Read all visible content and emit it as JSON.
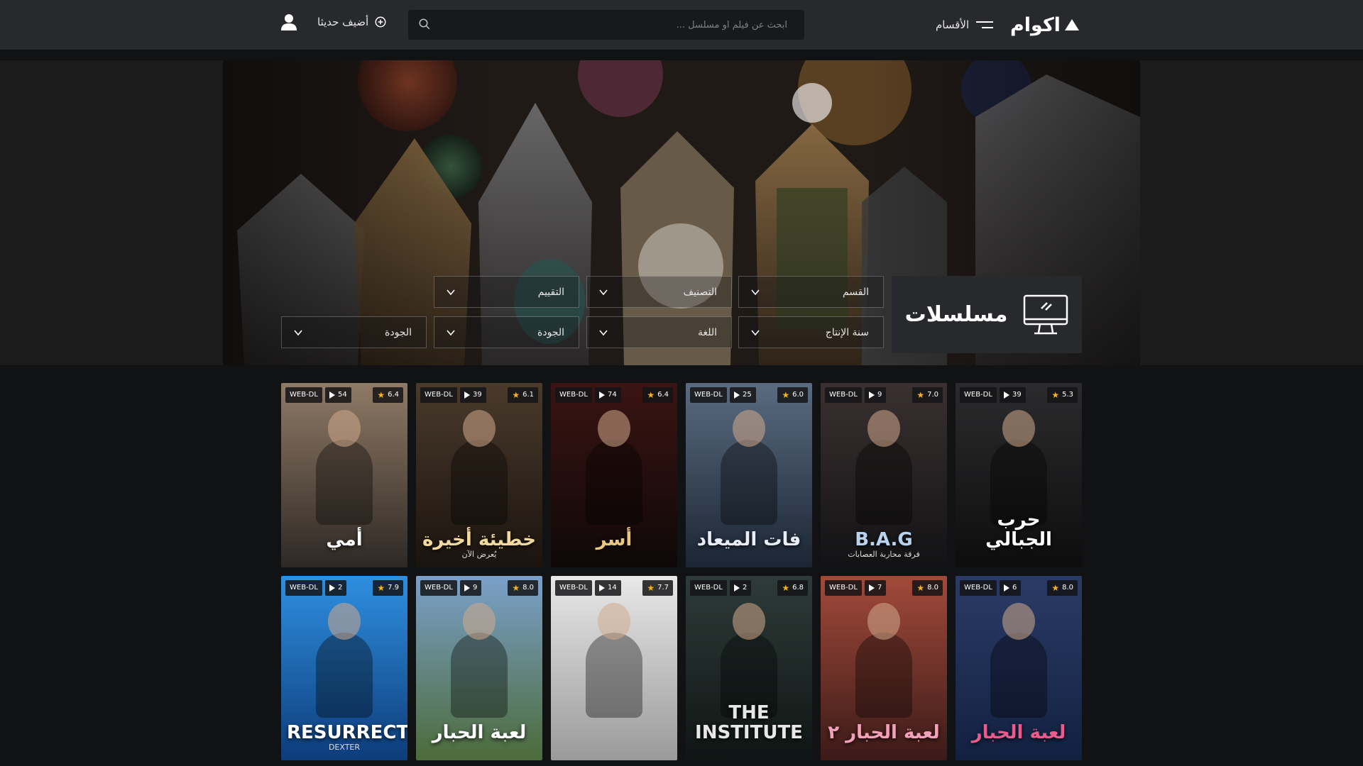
{
  "header": {
    "logo_text": "اكوام",
    "menu_label": "الأقسام",
    "search_placeholder": "ابحث عن فيلم او مسلسل ...",
    "add_new_label": "أضيف حديثا"
  },
  "hero": {
    "section_title": "مسلسلات",
    "filters_row1": [
      {
        "label": "القسم"
      },
      {
        "label": "التصنيف"
      },
      {
        "label": "التقييم"
      }
    ],
    "filters_row2": [
      {
        "label": "سنة الإنتاج"
      },
      {
        "label": "اللغة"
      },
      {
        "label": "الجودة"
      },
      {
        "label": "الجودة"
      }
    ]
  },
  "cards": [
    {
      "rating": "5.3",
      "episodes": "39",
      "quality": "WEB-DL",
      "title": "حرب الجبالي",
      "bg": [
        "#2b2b2d",
        "#0d0d0e"
      ],
      "title_color": "#ffffff"
    },
    {
      "rating": "7.0",
      "episodes": "9",
      "quality": "WEB-DL",
      "title": "B.A.G",
      "subtitle": "فرقة محاربة العصابات",
      "bg": [
        "#3a3030",
        "#121214"
      ],
      "title_color": "#b9d3ee"
    },
    {
      "rating": "6.0",
      "episodes": "25",
      "quality": "WEB-DL",
      "title": "فات الميعاد",
      "bg": [
        "#5a6b80",
        "#1b2534"
      ],
      "title_color": "#e9eef6"
    },
    {
      "rating": "6.4",
      "episodes": "74",
      "quality": "WEB-DL",
      "title": "أسر",
      "bg": [
        "#3a1412",
        "#0e0808"
      ],
      "title_color": "#e9c77f"
    },
    {
      "rating": "6.1",
      "episodes": "39",
      "quality": "WEB-DL",
      "title": "خطيئة أخيرة",
      "subtitle": "يُعرض الآن",
      "bg": [
        "#4a3a2c",
        "#1a130e"
      ],
      "title_color": "#f2d9a0"
    },
    {
      "rating": "6.4",
      "episodes": "54",
      "quality": "WEB-DL",
      "title": "أمي",
      "bg": [
        "#8f7a66",
        "#2e2824"
      ],
      "title_color": "#ffffff"
    },
    {
      "rating": "8.0",
      "episodes": "6",
      "quality": "WEB-DL",
      "title": "لعبة الحبار",
      "bg": [
        "#2b3b66",
        "#122040"
      ],
      "title_color": "#e95b8c"
    },
    {
      "rating": "8.0",
      "episodes": "7",
      "quality": "WEB-DL",
      "title": "لعبة الحبار ٢",
      "bg": [
        "#a24a3a",
        "#3b1a18"
      ],
      "title_color": "#f4a0bb"
    },
    {
      "rating": "6.8",
      "episodes": "2",
      "quality": "WEB-DL",
      "title": "THE INSTITUTE",
      "bg": [
        "#2e3b38",
        "#0f1514"
      ],
      "title_color": "#e8e8e8"
    },
    {
      "rating": "7.7",
      "episodes": "14",
      "quality": "WEB-DL",
      "title": "",
      "bg": [
        "#e8e8e8",
        "#9a9a9a"
      ],
      "title_color": "#222222"
    },
    {
      "rating": "8.0",
      "episodes": "9",
      "quality": "WEB-DL",
      "title": "لعبة الحبار",
      "bg": [
        "#7aa0c9",
        "#4c6b3a"
      ],
      "title_color": "#ffffff"
    },
    {
      "rating": "7.9",
      "episodes": "2",
      "quality": "WEB-DL",
      "title": "RESURRECTION",
      "subtitle": "DEXTER",
      "bg": [
        "#2f8fe0",
        "#0d3c7a"
      ],
      "title_color": "#ffffff"
    }
  ]
}
